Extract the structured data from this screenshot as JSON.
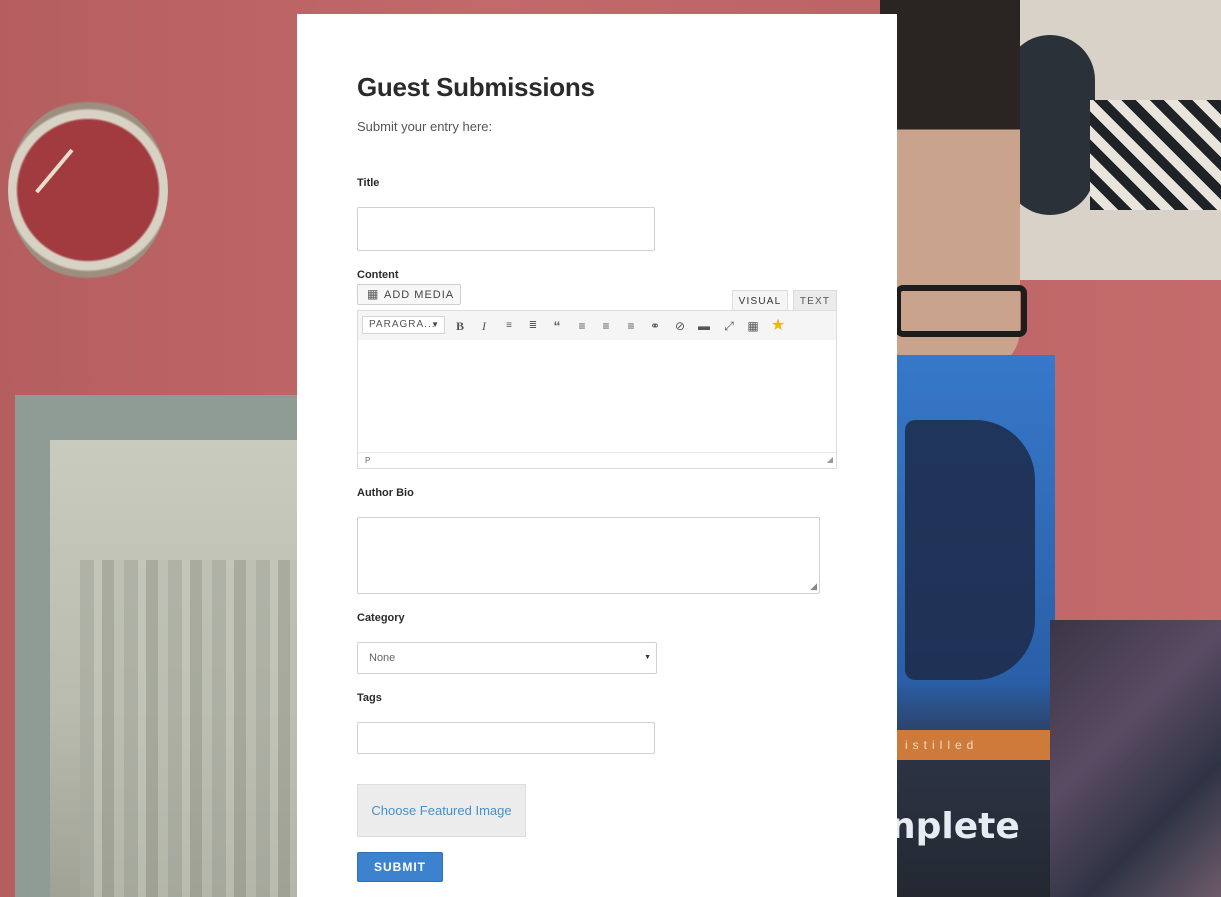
{
  "form": {
    "title": "Guest Submissions",
    "subtitle": "Submit your entry here:",
    "title_label": "Title",
    "title_value": "",
    "content_label": "Content",
    "add_media_label": "ADD MEDIA",
    "tab_visual_label": "VISUAL",
    "tab_text_label": "TEXT",
    "format_select": "PARAGRA...",
    "toolbar_icons": [
      "bold-icon",
      "italic-icon",
      "bullet-list-icon",
      "numbered-list-icon",
      "blockquote-icon",
      "align-left-icon",
      "align-center-icon",
      "align-right-icon",
      "link-icon",
      "unlink-icon",
      "read-more-icon",
      "fullscreen-icon",
      "toolbar-toggle-icon",
      "star-icon"
    ],
    "status_path": "P",
    "bio_label": "Author Bio",
    "category_label": "Category",
    "category_value": "None",
    "tags_label": "Tags",
    "featured_image_label": "Choose Featured Image",
    "submit_label": "SUBMIT"
  },
  "background": {
    "book_tag": "istilled",
    "book_word": "nplete"
  },
  "colors": {
    "accent": "#3d82cf",
    "link": "#4a90c8",
    "star": "#f2b705"
  }
}
